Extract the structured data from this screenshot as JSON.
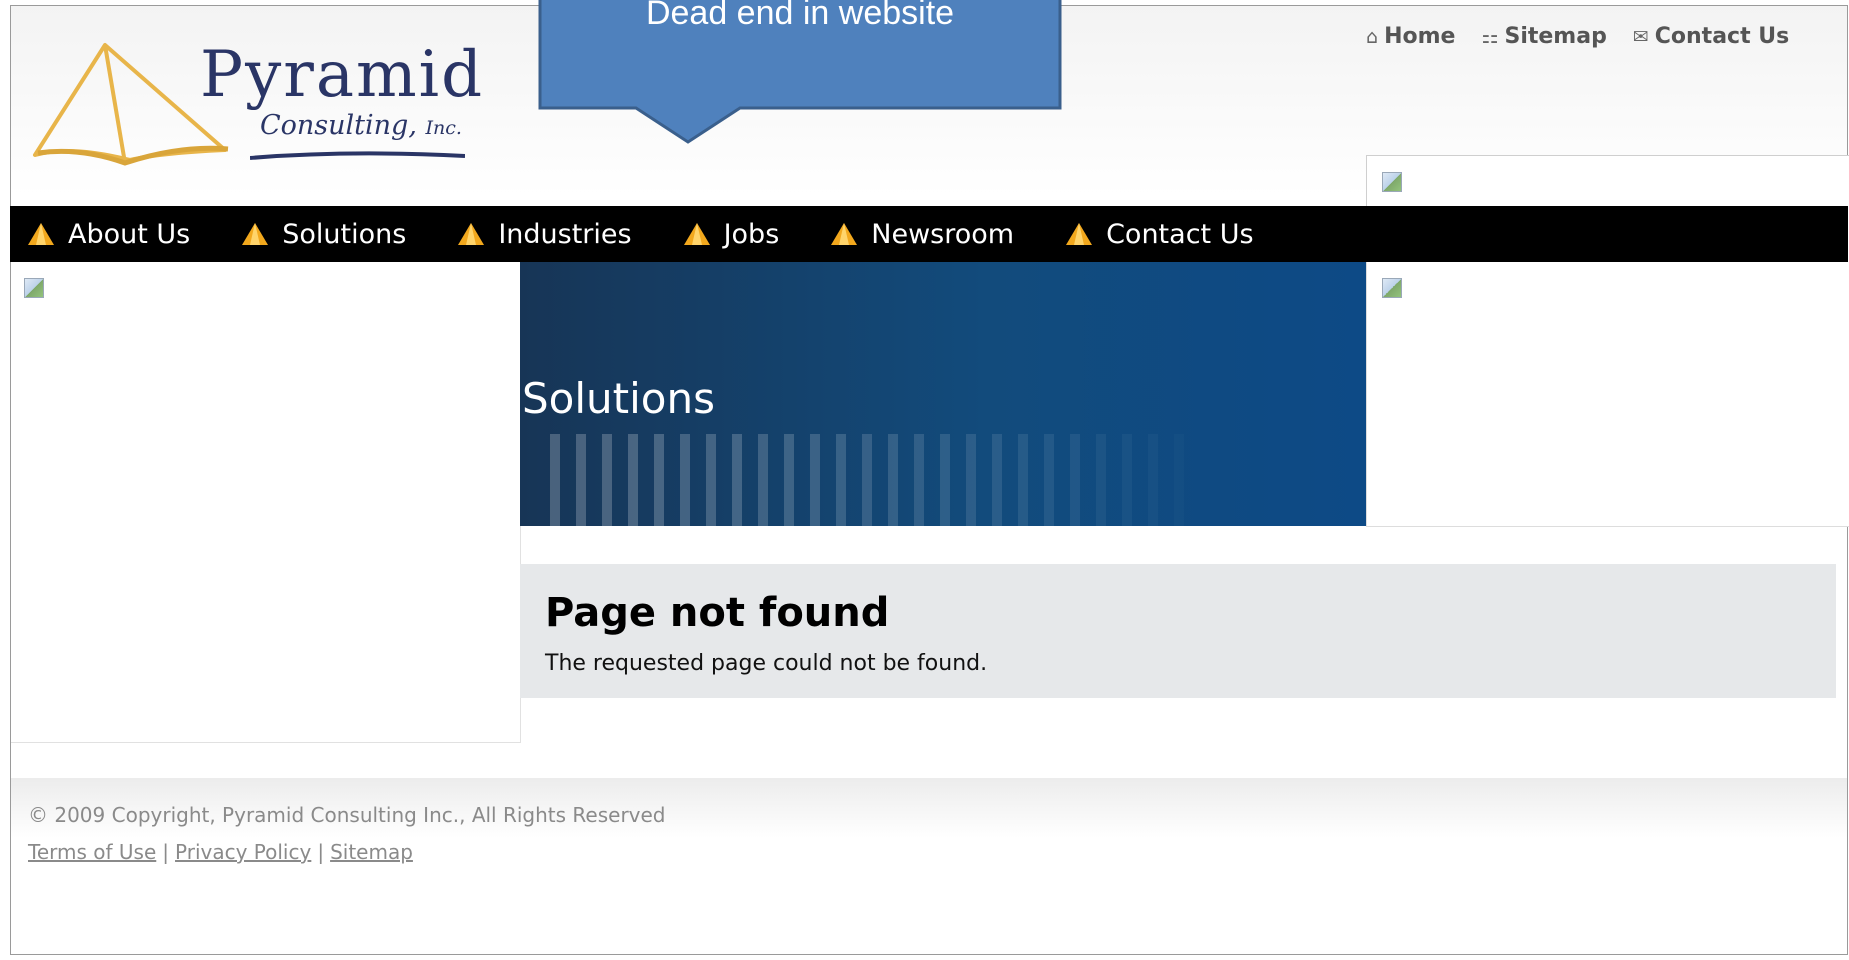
{
  "callout": {
    "label": "Dead end in website",
    "fill": "#4f81bd",
    "border": "#3a5f8c"
  },
  "logo": {
    "word": "Pyramid",
    "sub": "Consulting,",
    "sub_inc": "Inc."
  },
  "util_nav": [
    {
      "icon": "⌂",
      "icon_name": "home-icon",
      "label": "Home"
    },
    {
      "icon": "⚏",
      "icon_name": "sitemap-icon",
      "label": "Sitemap"
    },
    {
      "icon": "✉",
      "icon_name": "envelope-icon",
      "label": "Contact Us"
    }
  ],
  "nav": [
    {
      "label": "About Us"
    },
    {
      "label": "Solutions"
    },
    {
      "label": "Industries"
    },
    {
      "label": "Jobs"
    },
    {
      "label": "Newsroom"
    },
    {
      "label": "Contact Us"
    }
  ],
  "banner": {
    "title": "Solutions"
  },
  "content": {
    "heading": "Page not found",
    "message": "The requested page could not be found."
  },
  "footer": {
    "copyright": "© 2009 Copyright, Pyramid Consulting Inc., All Rights Reserved",
    "links": [
      "Terms of Use",
      "Privacy Policy",
      "Sitemap"
    ],
    "separator": "|"
  },
  "colors": {
    "nav_bg": "#000000",
    "pyramid_gold": "#e8b54a",
    "nav_bullet": "#f2a81d",
    "banner_blue": "#124b7c"
  }
}
